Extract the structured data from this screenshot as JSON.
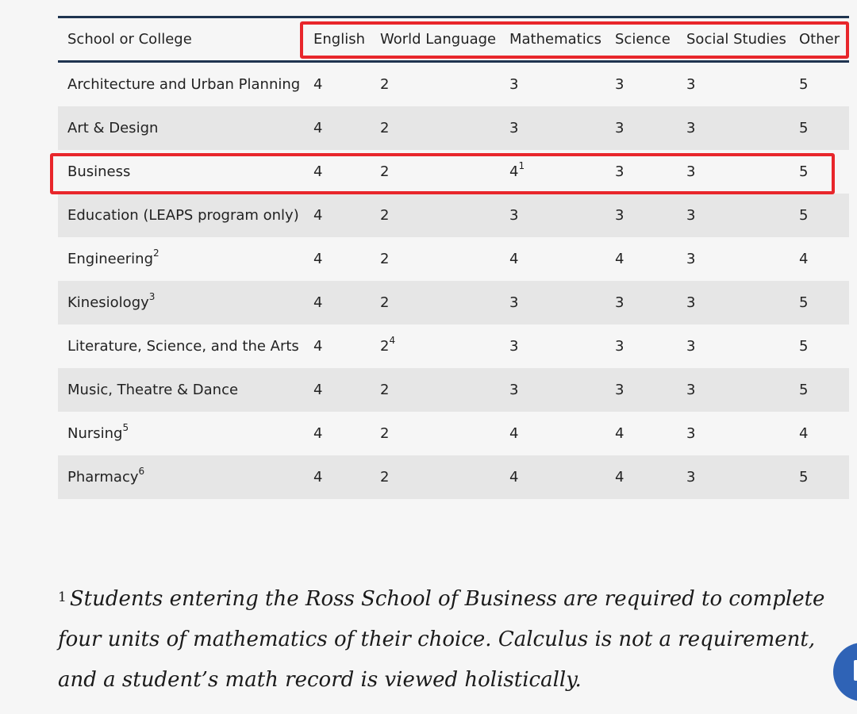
{
  "table": {
    "headers": [
      "School or College",
      "English",
      "World Language",
      "Mathematics",
      "Science",
      "Social Studies",
      "Other"
    ],
    "rows": [
      {
        "school": "Architecture and Urban Planning",
        "school_sup": "",
        "english": "4",
        "world_language": "2",
        "world_language_sup": "",
        "mathematics": "3",
        "mathematics_sup": "",
        "science": "3",
        "social_studies": "3",
        "other": "5"
      },
      {
        "school": "Art & Design",
        "school_sup": "",
        "english": "4",
        "world_language": "2",
        "world_language_sup": "",
        "mathematics": "3",
        "mathematics_sup": "",
        "science": "3",
        "social_studies": "3",
        "other": "5"
      },
      {
        "school": "Business",
        "school_sup": "",
        "english": "4",
        "world_language": "2",
        "world_language_sup": "",
        "mathematics": "4",
        "mathematics_sup": "1",
        "science": "3",
        "social_studies": "3",
        "other": "5"
      },
      {
        "school": "Education (LEAPS program only)",
        "school_sup": "",
        "english": "4",
        "world_language": "2",
        "world_language_sup": "",
        "mathematics": "3",
        "mathematics_sup": "",
        "science": "3",
        "social_studies": "3",
        "other": "5"
      },
      {
        "school": "Engineering",
        "school_sup": "2",
        "english": "4",
        "world_language": "2",
        "world_language_sup": "",
        "mathematics": "4",
        "mathematics_sup": "",
        "science": "4",
        "social_studies": "3",
        "other": "4"
      },
      {
        "school": "Kinesiology",
        "school_sup": "3",
        "english": "4",
        "world_language": "2",
        "world_language_sup": "",
        "mathematics": "3",
        "mathematics_sup": "",
        "science": "3",
        "social_studies": "3",
        "other": "5"
      },
      {
        "school": "Literature, Science, and the Arts",
        "school_sup": "",
        "english": "4",
        "world_language": "2",
        "world_language_sup": "4",
        "mathematics": "3",
        "mathematics_sup": "",
        "science": "3",
        "social_studies": "3",
        "other": "5"
      },
      {
        "school": "Music, Theatre & Dance",
        "school_sup": "",
        "english": "4",
        "world_language": "2",
        "world_language_sup": "",
        "mathematics": "3",
        "mathematics_sup": "",
        "science": "3",
        "social_studies": "3",
        "other": "5"
      },
      {
        "school": "Nursing",
        "school_sup": "5",
        "english": "4",
        "world_language": "2",
        "world_language_sup": "",
        "mathematics": "4",
        "mathematics_sup": "",
        "science": "4",
        "social_studies": "3",
        "other": "4"
      },
      {
        "school": "Pharmacy",
        "school_sup": "6",
        "english": "4",
        "world_language": "2",
        "world_language_sup": "",
        "mathematics": "4",
        "mathematics_sup": "",
        "science": "4",
        "social_studies": "3",
        "other": "5"
      }
    ]
  },
  "footnote": {
    "marker": "1",
    "text": "Students entering the Ross School of Business are required to complete four units of mathematics of their choice. Calculus is not a requirement, and a student’s math record is viewed holistically."
  },
  "annotations": {
    "highlight_color": "#e8262b",
    "highlighted_row": "Business"
  },
  "chat_widget": {
    "icon": "chat-icon",
    "color": "#2f63b6"
  }
}
